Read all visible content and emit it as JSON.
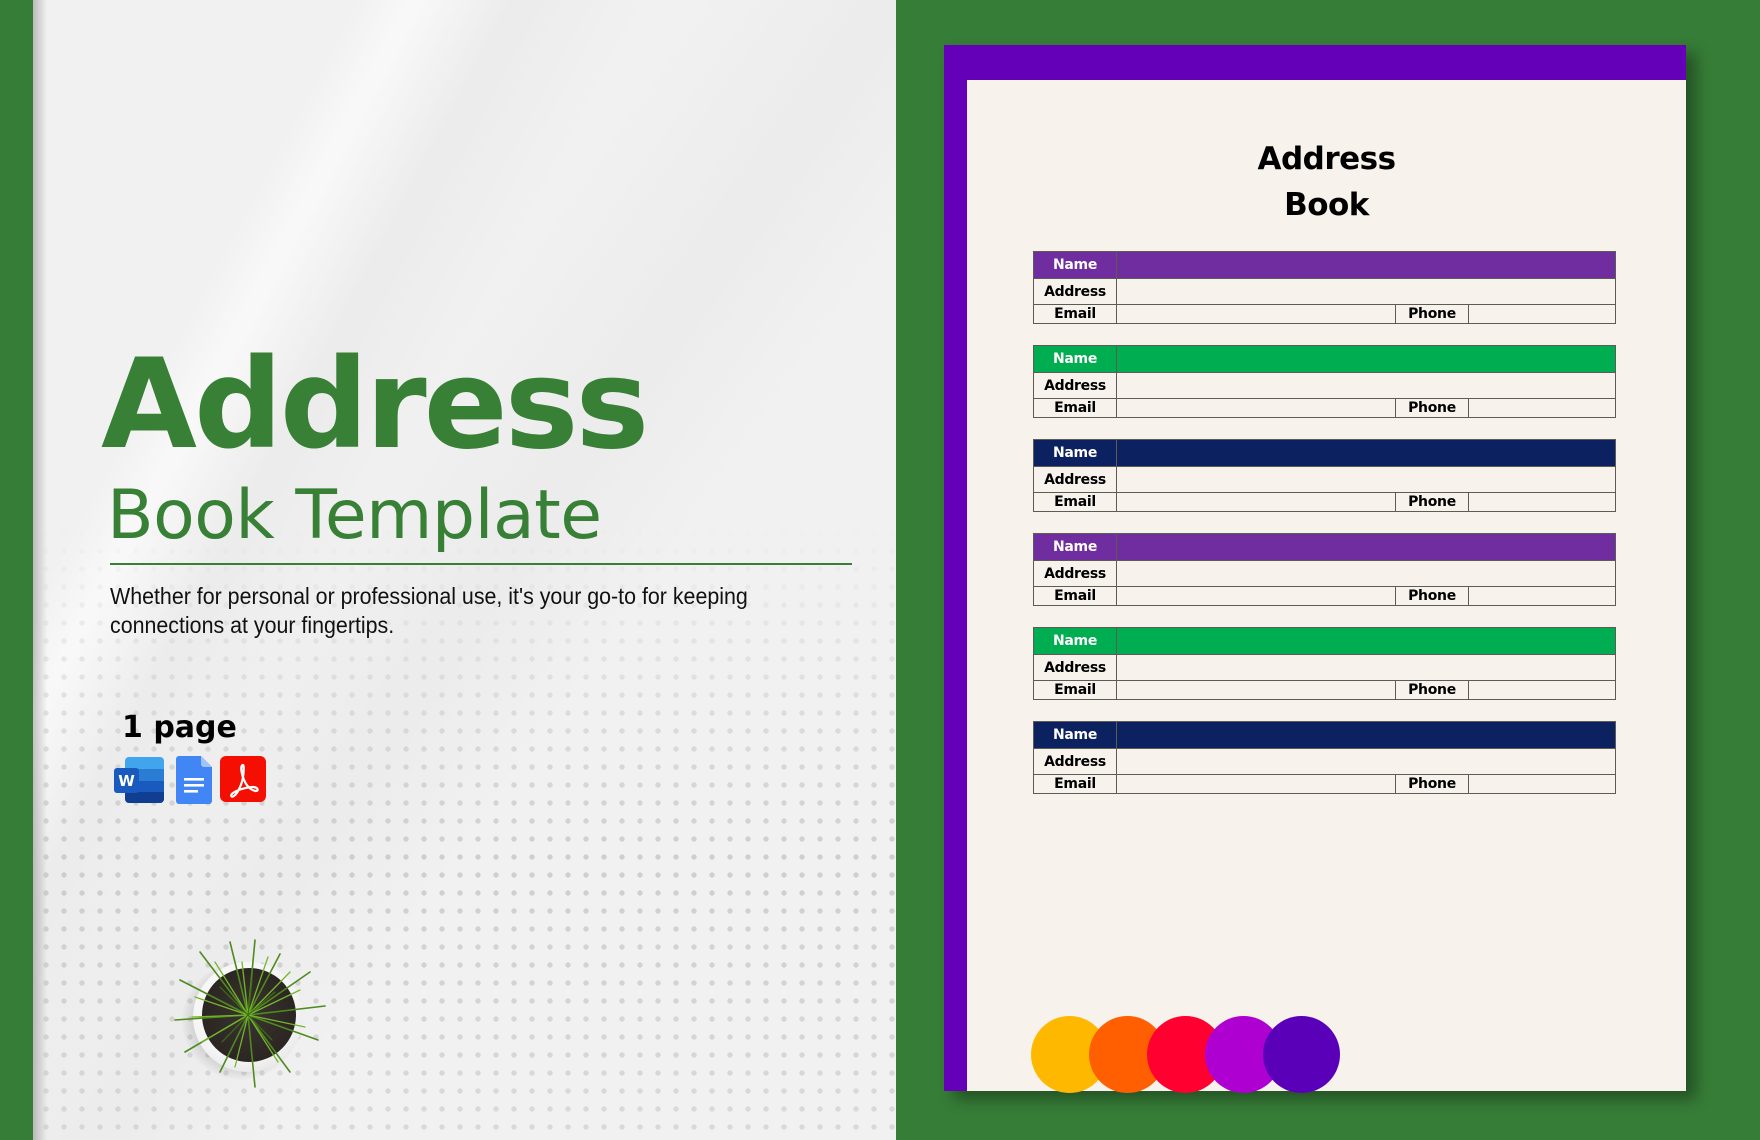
{
  "promo": {
    "title": "Address",
    "subtitle": "Book Template",
    "description": "Whether for personal or professional use, it's your go-to for keeping connections at your fingertips.",
    "page_count": "1 page",
    "formats": [
      {
        "name": "Microsoft Word",
        "icon": "word-icon",
        "letter": "W",
        "color": "#185abd"
      },
      {
        "name": "Google Docs",
        "icon": "google-docs-icon",
        "color": "#4285f4"
      },
      {
        "name": "PDF",
        "icon": "pdf-icon",
        "color": "#f40f02"
      }
    ],
    "accent_color": "#378036"
  },
  "document": {
    "title_line1": "Address",
    "title_line2": "Book",
    "frame_color": "#6400b8",
    "paper_color": "#f7f2ec",
    "labels": {
      "name": "Name",
      "address": "Address",
      "email": "Email",
      "phone": "Phone"
    },
    "entries": [
      {
        "header_color": "#6f2da0",
        "name": "",
        "address": "",
        "email": "",
        "phone": ""
      },
      {
        "header_color": "#00ad50",
        "name": "",
        "address": "",
        "email": "",
        "phone": ""
      },
      {
        "header_color": "#0c215f",
        "name": "",
        "address": "",
        "email": "",
        "phone": ""
      },
      {
        "header_color": "#6f2da0",
        "name": "",
        "address": "",
        "email": "",
        "phone": ""
      },
      {
        "header_color": "#00ad50",
        "name": "",
        "address": "",
        "email": "",
        "phone": ""
      },
      {
        "header_color": "#0c215f",
        "name": "",
        "address": "",
        "email": "",
        "phone": ""
      }
    ],
    "color_swatches": [
      "#ffb800",
      "#ff5f00",
      "#ff0030",
      "#ae00d0",
      "#5a00b8"
    ]
  },
  "background_color": "#367d37"
}
